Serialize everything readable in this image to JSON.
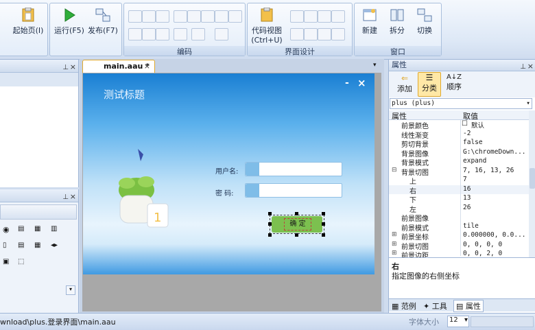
{
  "ribbon": {
    "start_page": "起始页(I)",
    "run": "运行(F5)",
    "publish": "发布(F7)",
    "group_edit": "编码",
    "code_view_line1": "代码视图",
    "code_view_line2": "(Ctrl+U)",
    "group_ui": "界面设计",
    "new": "新建",
    "split": "拆分",
    "switch": "切换",
    "group_window": "窗口"
  },
  "editor": {
    "tab_label": "main.aau *",
    "form_title": "测试标题",
    "username_label": "用户名:",
    "password_label": "密  码:",
    "ok_button": "确  定",
    "min_glyph": "-",
    "close_glyph": "×"
  },
  "properties": {
    "panel_title": "属性",
    "add": "添加",
    "categorize": "分类",
    "order": "顺序",
    "object_select": "plus (plus)",
    "col_name": "属性",
    "col_value": "取值",
    "rows": [
      {
        "name": "前景颜色",
        "value": "默认",
        "indent": 0
      },
      {
        "name": "线性渐变",
        "value": "-2",
        "indent": 0
      },
      {
        "name": "剪切背景",
        "value": "false",
        "indent": 0
      },
      {
        "name": "背景图像",
        "value": "G:\\chromeDown...",
        "indent": 0
      },
      {
        "name": "背景模式",
        "value": "expand",
        "indent": 0
      },
      {
        "name": "背景切图",
        "value": "7, 16, 13, 26",
        "indent": 0,
        "expander": "⊟"
      },
      {
        "name": "上",
        "value": "7",
        "indent": 1
      },
      {
        "name": "右",
        "value": "16",
        "indent": 1
      },
      {
        "name": "下",
        "value": "13",
        "indent": 1
      },
      {
        "name": "左",
        "value": "26",
        "indent": 1
      },
      {
        "name": "前景图像",
        "value": "",
        "indent": 0
      },
      {
        "name": "前景模式",
        "value": "tile",
        "indent": 0
      },
      {
        "name": "前景坐标",
        "value": "0.000000, 0.0...",
        "indent": 0,
        "expander": "⊞"
      },
      {
        "name": "前景切图",
        "value": "0, 0, 0, 0",
        "indent": 0,
        "expander": "⊞"
      },
      {
        "name": "前景边距",
        "value": "0, 0, 2, 0",
        "indent": 0,
        "expander": "⊞"
      }
    ],
    "desc_title": "右",
    "desc_text": "指定图像的右侧坐标",
    "bottom_tabs": [
      "范例",
      "工具",
      "属性"
    ]
  },
  "status": {
    "path": "wnload\\plus.登录界面\\main.aau",
    "font_size_label": "字体大小",
    "font_size_value": "12"
  },
  "colors": {
    "accent_orange": "#e0a92c",
    "ok_button_green": "#7cc04f",
    "ribbon_blue": "#cfdcef"
  }
}
